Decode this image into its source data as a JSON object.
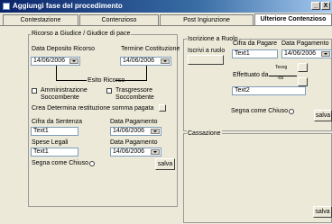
{
  "window": {
    "title": "Aggiungi fase del procedimento",
    "minimize": "_",
    "close": "X"
  },
  "tabs": [
    {
      "label": "Contestazione"
    },
    {
      "label": "Contenzioso"
    },
    {
      "label": "Post Ingiunzione"
    },
    {
      "label": "Ulteriore Contenzioso"
    }
  ],
  "left_group": {
    "title": "Ricorso a Giudice / Giudice di pace",
    "data_deposito_label": "Data Deposito Ricorso",
    "data_deposito_value": "14/06/2006",
    "termine_costituzione_label": "Termine Costituzione",
    "termine_costituzione_value": "14/06/2006",
    "esito_ricorso_label": "Esito Ricorso",
    "amministrazione_label": "Amministrazione",
    "amministrazione_sub": "Soccombente",
    "trasgressore_label": "Trasgressore",
    "trasgressore_sub": "Soccombente",
    "crea_determina_label": "Crea Determina restituzione somma pagata",
    "cifra_sentenza_label": "Cifra da Sentenza",
    "cifra_sentenza_value": "Text1",
    "data_pagamento1_label": "Data Pagamento",
    "data_pagamento1_value": "14/06/2006",
    "spese_legali_label": "Spese Legali",
    "spese_legali_value": "Text1",
    "data_pagamento2_label": "Data Pagamento",
    "data_pagamento2_value": "14/06/2006",
    "segna_chiuso_label": "Segna come Chiuso",
    "salva_label": "salva"
  },
  "right_top": {
    "title": "Iscrizione a Ruolo",
    "iscrivi_label": "Iscrivi a ruolo",
    "cifra_pagare_label": "Cifra da Pagare",
    "cifra_pagare_value": "Text1",
    "data_pagamento_label": "Data Pagamento",
    "data_pagamento_value": "14/06/2006",
    "effettuato_label": "Effettuato da",
    "tree_top": "Tesog",
    "tree_bottom": "-ca",
    "text2_value": "Text2",
    "segna_chiuso_label": "Segna come Chiuso",
    "salva_label": "salva"
  },
  "cassazione": {
    "title": "Cassazione",
    "salva_label": "salva"
  },
  "icons": {
    "app": "window-app-icon",
    "dropdown": "chevron-down-icon"
  }
}
